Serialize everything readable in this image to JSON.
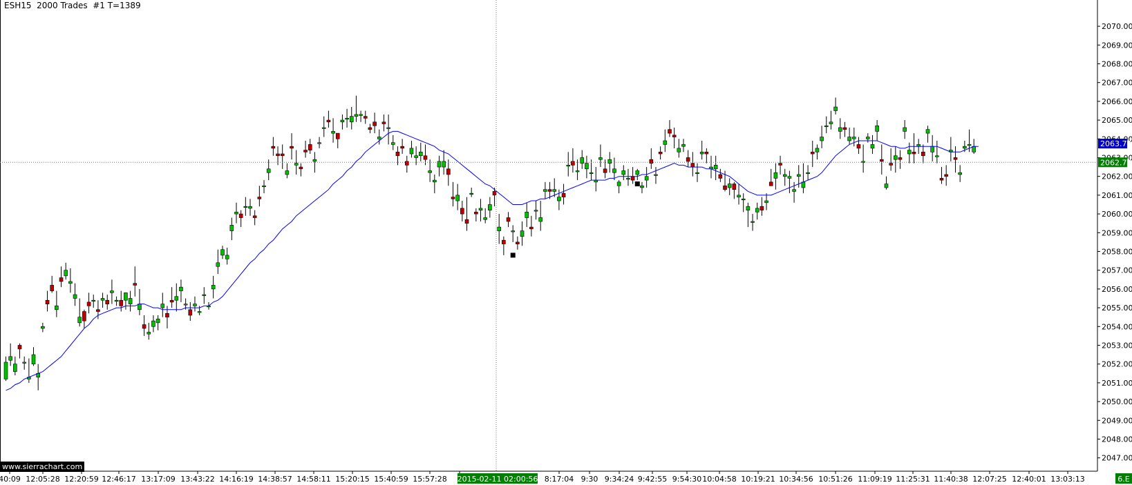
{
  "header": {
    "title": "ESH15  2000 Trades  #1 T=1389"
  },
  "watermark": "www.sierrachart.com",
  "crosshair": {
    "time_label": "2015-02-11  02:00:56",
    "price_label": "2062.75"
  },
  "last_price": {
    "label": "2063.75"
  },
  "corner_label": "6.E",
  "colors": {
    "up": "#00c000",
    "down": "#c00000",
    "wick": "#000000",
    "ma": "#0000ff",
    "last_price_bg": "#0000cc",
    "crosshair_bg": "#008000"
  },
  "chart_data": {
    "type": "candlestick",
    "title": "ESH15  2000 Trades  #1 T=1389",
    "ylim": [
      2046.4,
      2071.4
    ],
    "y_ticks": [
      "2047.00",
      "2048.00",
      "2049.00",
      "2050.00",
      "2051.00",
      "2052.00",
      "2053.00",
      "2054.00",
      "2055.00",
      "2056.00",
      "2057.00",
      "2058.00",
      "2059.00",
      "2060.00",
      "2061.00",
      "2062.00",
      "2063.00",
      "2064.00",
      "2065.00",
      "2066.00",
      "2067.00",
      "2068.00",
      "2069.00",
      "2070.00"
    ],
    "x_tick_labels": [
      "40:09",
      "12:05:28",
      "12:20:59",
      "12:46:17",
      "13:17:09",
      "13:43:22",
      "14:16:19",
      "14:38:57",
      "14:58:11",
      "15:20:15",
      "15:40:59",
      "15:57:28",
      "",
      "8:17:04",
      "9:30",
      "9:34:24",
      "9:42:55",
      "9:54:30",
      "10:04:58",
      "10:19:21",
      "10:34:56",
      "10:51:26",
      "11:09:19",
      "11:25:31",
      "11:40:38",
      "12:07:25",
      "12:40:01",
      "13:03:13"
    ],
    "close": [
      2052.1,
      2052.4,
      2052,
      2052.8,
      2052.1,
      2051.3,
      2052.5,
      2051.5,
      2054,
      2055.2,
      2055.9,
      2055.1,
      2056.4,
      2057,
      2056.4,
      2055.7,
      2054.5,
      2054.3,
      2055.1,
      2055.4,
      2054.8,
      2055.5,
      2055.2,
      2055.9,
      2055.4,
      2055.1,
      2055.8,
      2055.5,
      2056.2,
      2055.2,
      2053.9,
      2053.7,
      2054.3,
      2054.4,
      2055.2,
      2054.5,
      2055.3,
      2055.6,
      2056.1,
      2055.2,
      2054.6,
      2055.2,
      2054.8,
      2055.7,
      2055.1,
      2056.2,
      2057.4,
      2058.1,
      2057.8,
      2059.4,
      2060.1,
      2059.8,
      2060.4,
      2060.4,
      2059.8,
      2060.8,
      2061.5,
      2062.4,
      2063.5,
      2063.1,
      2063.1,
      2062.3,
      2063.5,
      2062.7,
      2062.4,
      2063.3,
      2063.4,
      2062.9,
      2063.8,
      2064.6,
      2064.9,
      2064.4,
      2064,
      2065,
      2065.1,
      2065.2,
      2065.3,
      2065.3,
      2065.1,
      2064.5,
      2064.7,
      2064.1,
      2064.8,
      2064.6,
      2063.8,
      2063.1,
      2063.5,
      2062.6,
      2063.5,
      2063.1,
      2063.3,
      2062.9,
      2062.3,
      2061.8,
      2062.8,
      2062.8,
      2062.1,
      2060.8,
      2061,
      2060,
      2059.5,
      2061.1,
      2060,
      2060.3,
      2059.8,
      2060.5,
      2061,
      2059.3,
      2058.4,
      2059.6,
      2059.1,
      2058.4,
      2059.1,
      2060.1,
      2059.2,
      2060.2,
      2059.8,
      2061.3,
      2061.2,
      2061.3,
      2060.9,
      2060.9,
      2062.6,
      2062.6,
      2062.3,
      2063,
      2062.7,
      2062.2,
      2061.8,
      2063,
      2062.2,
      2062.9,
      2062.4,
      2061.7,
      2062.3,
      2061.9,
      2061.8,
      2062.3,
      2061.5,
      2062,
      2062.7,
      2062.1,
      2063.2,
      2063.9,
      2064.3,
      2064.1,
      2063.5,
      2063.7,
      2062.8,
      2062.5,
      2062.2,
      2063.3,
      2063.2,
      2062.5,
      2062.6,
      2061.9,
      2061.3,
      2061.6,
      2061.3,
      2061,
      2060.8,
      2060.4,
      2059.6,
      2060.3,
      2060.2,
      2060.7,
      2061.5,
      2062.2,
      2062.6,
      2062.1,
      2062,
      2061.3,
      2062.1,
      2061.7,
      2062.2,
      2063.2,
      2063.5,
      2064.1,
      2064.7,
      2064.9,
      2065.7,
      2064.6,
      2064.5,
      2064.1,
      2064.1,
      2063.5,
      2062.8,
      2064.1,
      2063.7,
      2064.7,
      2062.8,
      2061.6,
      2062.6,
      2063.1,
      2062.9,
      2064.6,
      2063.4,
      2063.2,
      2063.7,
      2063.1,
      2064.5,
      2063.6,
      2063.1,
      2061.8,
      2062,
      2063.4,
      2062.9,
      2062.2,
      2063.6,
      2063.7,
      2063.6,
      2063.8
    ],
    "opens": [
      2051.2,
      2052.2,
      2051.6,
      2053,
      2052.1,
      2051.2,
      2052,
      2051.3,
      2053.9,
      2055.4,
      2056.2,
      2054.9,
      2056.6,
      2056.7,
      2056.3,
      2055.5,
      2054.2,
      2054.8,
      2055.3,
      2055.4,
      2054.9,
      2055.4,
      2055.4,
      2055.8,
      2055.4,
      2055.4,
      2055.4,
      2055.2,
      2056.3,
      2054.9,
      2054.1,
      2053.6,
      2054,
      2054.2,
      2055,
      2054.7,
      2055.4,
      2055.4,
      2055.9,
      2055.2,
      2054.9,
      2055.1,
      2054.8,
      2055.7,
      2055.1,
      2056,
      2057.2,
      2057.8,
      2057.6,
      2059.1,
      2060,
      2060,
      2060.4,
      2060.3,
      2059.9,
      2060.9,
      2061.5,
      2062.2,
      2063.6,
      2063.2,
      2063.2,
      2062.1,
      2063.6,
      2062.6,
      2062.5,
      2063.4,
      2063.7,
      2062.8,
      2063.8,
      2064.6,
      2065,
      2064.3,
      2064.3,
      2064.9,
      2065.1,
      2064.9,
      2065.2,
      2065.3,
      2065.2,
      2064.6,
      2064.9,
      2064,
      2064.9,
      2064.6,
      2063.7,
      2063.3,
      2063.6,
      2062.8,
      2063.2,
      2063,
      2063.1,
      2063.1,
      2062.2,
      2061.7,
      2062.5,
      2062.5,
      2062.4,
      2060.9,
      2060.7,
      2060.3,
      2059.7,
      2061.1,
      2060.1,
      2060.2,
      2059.7,
      2060.2,
      2061.2,
      2059.1,
      2058.6,
      2059.8,
      2059.1,
      2058.5,
      2058.8,
      2059.8,
      2059.3,
      2060.2,
      2059.6,
      2061.2,
      2061.3,
      2061.2,
      2060.7,
      2061.1,
      2062.6,
      2062.8,
      2062.3,
      2062.7,
      2062.4,
      2062.2,
      2061.7,
      2062.9,
      2062.4,
      2062.7,
      2062.2,
      2061.5,
      2062.1,
      2061.9,
      2062,
      2062.1,
      2061.4,
      2061.8,
      2062.9,
      2062.1,
      2063.3,
      2063.7,
      2064.5,
      2064.2,
      2063.3,
      2063.6,
      2063,
      2062.7,
      2062.2,
      2063.2,
      2063.3,
      2062.4,
      2062.4,
      2062.1,
      2061.5,
      2061.4,
      2061.6,
      2060.9,
      2060.8,
      2060.2,
      2059.6,
      2060.1,
      2060.4,
      2060.6,
      2061.7,
      2061.9,
      2062.7,
      2062,
      2061.9,
      2061.2,
      2062,
      2061.4,
      2062.2,
      2063.3,
      2063.3,
      2063.9,
      2064.7,
      2064.8,
      2065.5,
      2064.4,
      2064.6,
      2063.9,
      2064,
      2063.7,
      2062.8,
      2064,
      2063.5,
      2064.4,
      2062.9,
      2061.4,
      2062.7,
      2062.9,
      2063,
      2064.4,
      2063.2,
      2063.3,
      2063.6,
      2063.3,
      2064.3,
      2063.3,
      2063.1,
      2061.9,
      2062.1,
      2063.3,
      2063,
      2062.1,
      2063.5,
      2063.7,
      2063.3
    ],
    "highs": [
      2052.4,
      2053.1,
      2052.4,
      2053.1,
      2052.4,
      2052.3,
      2052.9,
      2052,
      2054.2,
      2055.9,
      2056.7,
      2055.9,
      2057.2,
      2057.4,
      2057.1,
      2056.3,
      2055.5,
      2054.9,
      2055.8,
      2055.7,
      2055.4,
      2055.8,
      2055.7,
      2056.5,
      2055.6,
      2055.9,
      2055.8,
      2055.9,
      2057.2,
      2056,
      2054.6,
      2054.2,
      2054.6,
      2054.6,
      2055.8,
      2055.1,
      2056.1,
      2056.3,
      2056.5,
      2055.5,
      2055.3,
      2055.6,
      2055.1,
      2056.1,
      2055.3,
      2056.7,
      2058.1,
      2058.3,
      2058.2,
      2059.8,
      2060.6,
      2060.2,
      2060.9,
      2060.8,
      2060.2,
      2061.5,
      2061.8,
      2062.9,
      2064.1,
      2063.6,
      2063.7,
      2062.7,
      2064.3,
      2063.4,
      2062.7,
      2063.9,
      2064,
      2063.3,
      2064.1,
      2065.2,
      2065.5,
      2065.1,
      2064.3,
      2065.3,
      2065.6,
      2065.7,
      2066.3,
      2065.5,
      2065.5,
      2064.8,
      2065.4,
      2064.5,
      2065.3,
      2065.3,
      2064.2,
      2063.6,
      2064,
      2063.1,
      2063.9,
      2063.6,
      2063.8,
      2063.7,
      2062.9,
      2062.1,
      2063.1,
      2063.4,
      2062.9,
      2061.7,
      2061.6,
      2060.7,
      2060.9,
      2061.4,
      2060.3,
      2060.8,
      2060.3,
      2060.9,
      2061.4,
      2060,
      2058.8,
      2060.1,
      2059.4,
      2058.8,
      2059.6,
      2060.6,
      2059.9,
      2060.7,
      2060.7,
      2061.7,
      2061.7,
      2061.9,
      2061.3,
      2061.6,
      2063.3,
      2063.5,
      2062.9,
      2063.4,
      2063.1,
      2062.9,
      2062.5,
      2063.7,
      2062.9,
      2063.3,
      2063,
      2061.8,
      2062.6,
      2062.4,
      2062.5,
      2062.4,
      2061.7,
      2062.5,
      2063.5,
      2062.5,
      2063.6,
      2064.5,
      2065,
      2064.6,
      2064,
      2064,
      2063.4,
      2063.3,
      2062.7,
      2063.9,
      2063.5,
      2063.1,
      2063.1,
      2062.4,
      2062.3,
      2061.9,
      2061.7,
      2061.6,
      2061.1,
      2060.6,
      2060,
      2060.6,
      2060.9,
      2061.1,
      2062.4,
      2062.7,
      2063.1,
      2062.4,
      2062.3,
      2061.7,
      2062.6,
      2062.7,
      2062.6,
      2063.9,
      2063.7,
      2064.7,
      2065.2,
      2065.5,
      2066.2,
      2065.1,
      2064.9,
      2064.6,
      2064.6,
      2064.1,
      2063.7,
      2064.3,
      2064.2,
      2065,
      2063.7,
      2062,
      2063.5,
      2063.6,
      2063.4,
      2065,
      2063.8,
      2064.3,
      2064,
      2063.7,
      2064.7,
      2064.2,
      2063.9,
      2062.5,
      2062.6,
      2064.1,
      2063.6,
      2062.6,
      2063.9,
      2064.5,
      2064
    ],
    "lows": [
      2051.1,
      2051.9,
      2051.4,
      2052.3,
      2051.7,
      2051,
      2051.9,
      2050.6,
      2053.7,
      2054.8,
      2055.8,
      2054.5,
      2056.1,
      2056.5,
      2055.8,
      2055.1,
      2054,
      2053.9,
      2054.7,
      2055,
      2054.4,
      2055,
      2054.9,
      2055.2,
      2055.1,
      2054.8,
      2054.9,
      2054.8,
      2055.6,
      2054.6,
      2053.5,
      2053.3,
      2053.7,
      2053.8,
      2054.5,
      2053.9,
      2055,
      2054.8,
      2055.3,
      2054.9,
      2054.3,
      2054.8,
      2054.6,
      2055.2,
      2054.9,
      2055.5,
      2056.8,
      2057.6,
      2057.3,
      2058.6,
      2059.5,
      2059.3,
      2059.9,
      2059.9,
      2059.4,
      2060.4,
      2061.1,
      2061.8,
      2063.1,
      2062.6,
      2062.4,
      2061.9,
      2062.9,
      2062.1,
      2062,
      2063,
      2063.2,
      2062.2,
      2063.5,
      2064.1,
      2064.6,
      2063.8,
      2063.5,
      2064.5,
      2064.6,
      2064.5,
      2064.9,
      2064.9,
      2064.8,
      2064.3,
      2064.3,
      2063.7,
      2064.4,
      2063.7,
      2063.4,
      2062.6,
      2063.2,
      2062.2,
      2063,
      2062.6,
      2062.8,
      2062.6,
      2061.7,
      2061.1,
      2062,
      2062.1,
      2061.5,
      2060.4,
      2060.2,
      2059.6,
      2059.1,
      2060.9,
      2059.6,
      2059.6,
      2059.5,
      2059.8,
      2060.4,
      2058.4,
      2057.8,
      2059.3,
      2058.5,
      2058.1,
      2058.3,
      2059.3,
      2058.8,
      2059.7,
      2059.1,
      2060.8,
      2060.8,
      2060.9,
      2060.2,
      2060.5,
      2062,
      2062.2,
      2061.8,
      2062.4,
      2061.9,
      2061.8,
      2061.2,
      2062.5,
      2061.9,
      2062.2,
      2061.8,
      2061.1,
      2061.8,
      2061.5,
      2061.6,
      2061.8,
      2061.1,
      2061.4,
      2062.4,
      2061.6,
      2062.9,
      2063.3,
      2064.1,
      2063.5,
      2063,
      2063.3,
      2062.5,
      2062,
      2061.7,
      2062.9,
      2062.7,
      2061.9,
      2061.8,
      2061.7,
      2061.2,
      2061,
      2060.8,
      2060.5,
      2060.1,
      2059.3,
      2059.1,
      2059.7,
      2059.9,
      2060.2,
      2061.5,
      2061.3,
      2062.1,
      2061.5,
      2061.1,
      2060.6,
      2061.4,
      2061.1,
      2061.8,
      2062.5,
      2062.9,
      2063.5,
      2064.3,
      2064.5,
      2065.3,
      2064,
      2064.1,
      2063.7,
      2063.6,
      2063.2,
      2062.2,
      2063.8,
      2063.2,
      2063.9,
      2062.1,
      2061.3,
      2062.3,
      2062.2,
      2062.4,
      2064,
      2062.7,
      2062.7,
      2063.2,
      2062.7,
      2063.8,
      2062.8,
      2062.7,
      2061.6,
      2061.5,
      2062.8,
      2062.2,
      2061.7,
      2063.3,
      2063.3,
      2063.2
    ],
    "moving_average": [
      2050.6,
      2050.7,
      2050.9,
      2051,
      2051.2,
      2051.3,
      2051.4,
      2051.5,
      2051.6,
      2051.8,
      2052,
      2052.2,
      2052.4,
      2052.7,
      2053,
      2053.3,
      2053.6,
      2053.9,
      2054.1,
      2054.4,
      2054.6,
      2054.7,
      2054.8,
      2054.9,
      2055,
      2055,
      2055.1,
      2055.1,
      2055.1,
      2055.2,
      2055.2,
      2055.1,
      2055,
      2055,
      2054.9,
      2054.9,
      2054.9,
      2054.9,
      2054.9,
      2055,
      2055,
      2055,
      2055,
      2055.1,
      2055.1,
      2055.3,
      2055.4,
      2055.6,
      2055.9,
      2056.2,
      2056.5,
      2056.8,
      2057.1,
      2057.4,
      2057.6,
      2057.9,
      2058.1,
      2058.4,
      2058.6,
      2058.9,
      2059.2,
      2059.4,
      2059.6,
      2059.9,
      2060.1,
      2060.3,
      2060.5,
      2060.7,
      2060.9,
      2061.1,
      2061.3,
      2061.6,
      2061.8,
      2062,
      2062.3,
      2062.5,
      2062.8,
      2063,
      2063.3,
      2063.5,
      2063.7,
      2063.9,
      2064.1,
      2064.3,
      2064.4,
      2064.4,
      2064.3,
      2064.2,
      2064.1,
      2064,
      2063.9,
      2063.8,
      2063.7,
      2063.6,
      2063.4,
      2063.3,
      2063.2,
      2063,
      2062.8,
      2062.6,
      2062.4,
      2062.2,
      2062,
      2061.8,
      2061.6,
      2061.5,
      2061.3,
      2061.1,
      2060.9,
      2060.7,
      2060.5,
      2060.5,
      2060.5,
      2060.6,
      2060.7,
      2060.7,
      2060.8,
      2060.8,
      2060.9,
      2061,
      2061.1,
      2061.2,
      2061.3,
      2061.4,
      2061.5,
      2061.6,
      2061.7,
      2061.8,
      2061.8,
      2061.8,
      2061.8,
      2061.9,
      2061.9,
      2062,
      2062,
      2062,
      2062,
      2062,
      2062.1,
      2062.1,
      2062.2,
      2062.3,
      2062.4,
      2062.5,
      2062.6,
      2062.7,
      2062.6,
      2062.6,
      2062.5,
      2062.5,
      2062.5,
      2062.5,
      2062.4,
      2062.4,
      2062.3,
      2062.2,
      2062.1,
      2062,
      2061.8,
      2061.6,
      2061.4,
      2061.2,
      2061.1,
      2061,
      2061,
      2061,
      2061,
      2061.1,
      2061.2,
      2061.3,
      2061.4,
      2061.5,
      2061.6,
      2061.7,
      2061.8,
      2061.9,
      2062,
      2062.2,
      2062.5,
      2062.8,
      2063.1,
      2063.3,
      2063.5,
      2063.7,
      2063.8,
      2063.9,
      2063.9,
      2063.9,
      2063.9,
      2063.9,
      2063.8,
      2063.7,
      2063.6,
      2063.6,
      2063.5,
      2063.5,
      2063.6,
      2063.6,
      2063.6,
      2063.6,
      2063.6,
      2063.6,
      2063.6,
      2063.5,
      2063.4,
      2063.3,
      2063.3,
      2063.3,
      2063.4,
      2063.5,
      2063.6,
      2063.6
    ],
    "markers": [
      {
        "bar_index": 110,
        "price": 2057.8,
        "shape": "square"
      },
      {
        "bar_index": 137,
        "price": 2061.6,
        "shape": "square"
      }
    ],
    "last_price": 2063.75,
    "crosshair_price": 2062.75
  }
}
